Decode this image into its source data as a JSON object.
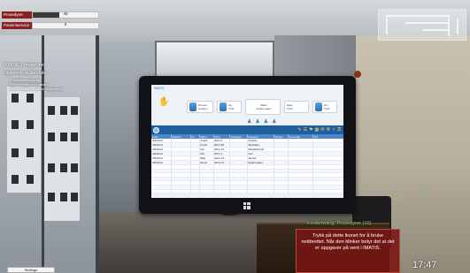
{
  "hud": {
    "bars": [
      {
        "label": "Prosedyrer",
        "value": "40",
        "fill": 0.4
      },
      {
        "label": "Pasientservice",
        "value": "0",
        "fill": 0.0
      }
    ],
    "tasks": {
      "title": "00:49/03 ringer inn",
      "subtitle": "Utgående studerende",
      "items": [
        "+Pasienten ringer på",
        "+Hent medisiner til pasient",
        "+Hent medisiner klar for registrering"
      ]
    }
  },
  "tablet": {
    "app_name": "IMATIS",
    "cards": [
      {
        "name": "Nomen",
        "sub": "Lindsen"
      },
      {
        "name": "Hjj",
        "sub": "Tyrik"
      },
      {
        "name": "Møter",
        "sub": "Anders Hjem"
      },
      {
        "name": "Hjem",
        "sub": "Tyrik"
      },
      {
        "name": "Hm",
        "sub": "Tyrik"
      }
    ],
    "table": {
      "columns": [
        "Dato",
        "Pasient",
        "Kl.",
        "Navn",
        "Rom",
        "Oppgave",
        "Kategori",
        "Status",
        "Ansvarlig",
        "Tid"
      ],
      "rows": [
        [
          "4/6/2014",
          "",
          "",
          "Grazit",
          "EKG 6",
          "",
          "PostOp",
          "",
          "",
          ""
        ],
        [
          "4/6/2014",
          "",
          "",
          "Frank",
          "EKG 66",
          "",
          "Sentralen",
          "",
          "",
          ""
        ],
        [
          "4/6/2014",
          "",
          "",
          "Per",
          "EKG 16",
          "",
          "Rehab/Innskr",
          "",
          "",
          ""
        ],
        [
          "4/6/2014",
          "",
          "",
          "Ida",
          "EKG 1",
          "",
          "Kirlr",
          "",
          "",
          ""
        ],
        [
          "4/6/2014",
          "",
          "",
          "Bilje",
          "EKG 14",
          "",
          "Sterrid",
          "",
          "",
          ""
        ],
        [
          "4/6/2014",
          "",
          "",
          "Enein",
          "EKG 12",
          "",
          "Kjelleroyktet",
          "",
          "",
          ""
        ],
        [
          "",
          "",
          "",
          "",
          "",
          "",
          "",
          "",
          "",
          ""
        ],
        [
          "",
          "",
          "",
          "",
          "",
          "",
          "",
          "",
          "",
          ""
        ],
        [
          "",
          "",
          "",
          "",
          "",
          "",
          "",
          "",
          "",
          ""
        ],
        [
          "",
          "",
          "",
          "",
          "",
          "",
          "",
          "",
          "",
          ""
        ],
        [
          "",
          "",
          "",
          "",
          "",
          "",
          "",
          "",
          "",
          ""
        ],
        [
          "",
          "",
          "",
          "",
          "",
          "",
          "",
          "",
          "",
          ""
        ],
        [
          "",
          "",
          "",
          "",
          "",
          "",
          "",
          "",
          "",
          ""
        ]
      ]
    }
  },
  "notification": {
    "header": "Forskrivning: Prosedyrer (10)",
    "text": "Trykk på dette ikonet for å bruke nettbrettet. Når den blinker betyr det at det er oppgaver på vent i IMATIS."
  },
  "clock": "17:47",
  "bottom_button": "Settings"
}
